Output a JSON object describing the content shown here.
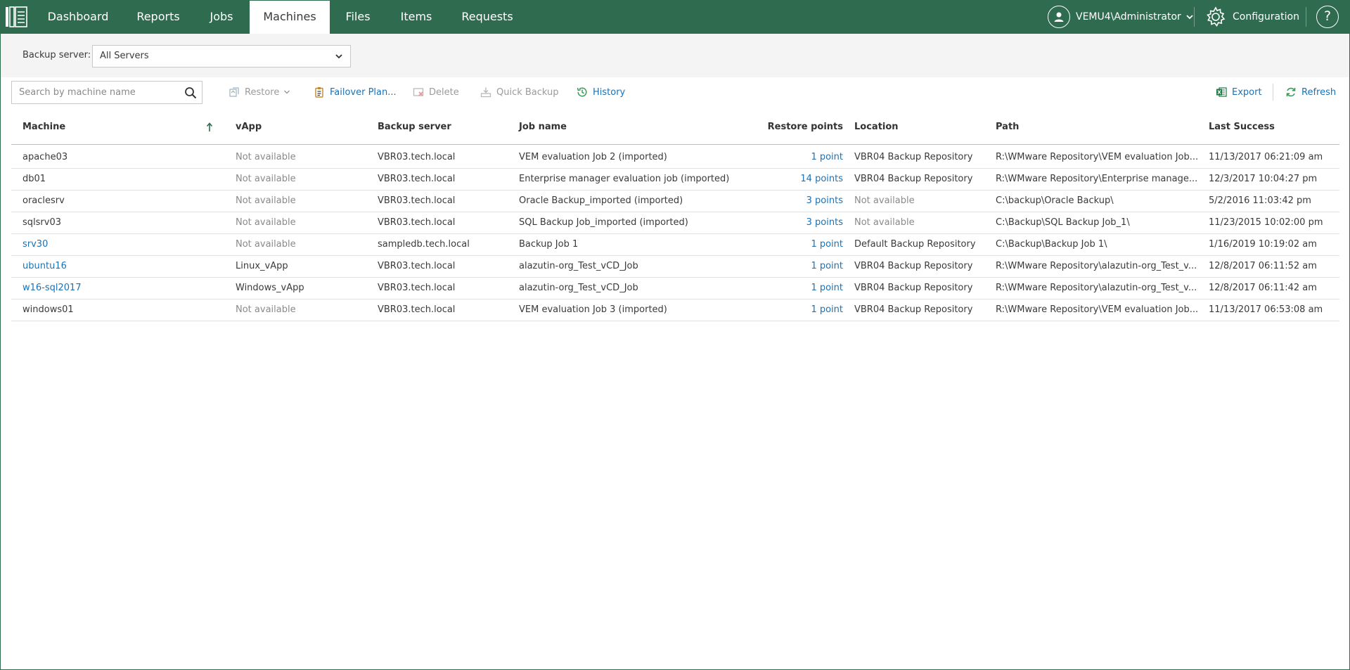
{
  "nav": {
    "tabs": [
      {
        "label": "Dashboard"
      },
      {
        "label": "Reports"
      },
      {
        "label": "Jobs"
      },
      {
        "label": "Machines"
      },
      {
        "label": "Files"
      },
      {
        "label": "Items"
      },
      {
        "label": "Requests"
      }
    ],
    "active_tab": "Machines",
    "user": "VEMU4\\Administrator",
    "config_label": "Configuration",
    "help_label": "?"
  },
  "filter": {
    "label": "Backup server:",
    "value": "All Servers"
  },
  "toolbar": {
    "search_placeholder": "Search by machine name",
    "restore": "Restore",
    "failover": "Failover Plan...",
    "delete": "Delete",
    "quick_backup": "Quick Backup",
    "history": "History",
    "export": "Export",
    "refresh": "Refresh"
  },
  "table": {
    "headers": {
      "machine": "Machine",
      "vapp": "vApp",
      "backup_server": "Backup server",
      "job_name": "Job name",
      "restore_points": "Restore points",
      "location": "Location",
      "path": "Path",
      "last_success": "Last Success"
    },
    "rows": [
      {
        "machine": "apache03",
        "vapp": "Not available",
        "backup_server": "VBR03.tech.local",
        "job_name": "VEM evaluation Job 2 (imported)",
        "restore_points": "1 point",
        "location": "VBR04 Backup Repository",
        "path": "R:\\WMware Repository\\VEM evaluation Job...",
        "last_success": "11/13/2017 06:21:09 am"
      },
      {
        "machine": "db01",
        "vapp": "Not available",
        "backup_server": "VBR03.tech.local",
        "job_name": "Enterprise manager evaluation job (imported)",
        "restore_points": "14 points",
        "location": "VBR04 Backup Repository",
        "path": "R:\\WMware Repository\\Enterprise manage...",
        "last_success": "12/3/2017 10:04:27 pm"
      },
      {
        "machine": "oraclesrv",
        "vapp": "Not available",
        "backup_server": "VBR03.tech.local",
        "job_name": "Oracle Backup_imported (imported)",
        "restore_points": "3 points",
        "location": "Not available",
        "path": "C:\\backup\\Oracle Backup\\",
        "last_success": "5/2/2016 11:03:42 pm"
      },
      {
        "machine": "sqlsrv03",
        "vapp": "Not available",
        "backup_server": "VBR03.tech.local",
        "job_name": "SQL Backup Job_imported (imported)",
        "restore_points": "3 points",
        "location": "Not available",
        "path": "C:\\Backup\\SQL Backup Job_1\\",
        "last_success": "11/23/2015 10:02:00 pm"
      },
      {
        "machine": "srv30",
        "vapp": "Not available",
        "backup_server": "sampledb.tech.local",
        "job_name": "Backup Job 1",
        "restore_points": "1 point",
        "location": "Default Backup Repository",
        "path": "C:\\Backup\\Backup Job 1\\",
        "last_success": "1/16/2019 10:19:02 am"
      },
      {
        "machine": "ubuntu16",
        "vapp": "Linux_vApp",
        "backup_server": "VBR03.tech.local",
        "job_name": "alazutin-org_Test_vCD_Job",
        "restore_points": "1 point",
        "location": "VBR04 Backup Repository",
        "path": "R:\\WMware Repository\\alazutin-org_Test_v...",
        "last_success": "12/8/2017 06:11:52 am"
      },
      {
        "machine": "w16-sql2017",
        "vapp": "Windows_vApp",
        "backup_server": "VBR03.tech.local",
        "job_name": "alazutin-org_Test_vCD_Job",
        "restore_points": "1 point",
        "location": "VBR04 Backup Repository",
        "path": "R:\\WMware Repository\\alazutin-org_Test_v...",
        "last_success": "12/8/2017 06:11:42 am"
      },
      {
        "machine": "windows01",
        "vapp": "Not available",
        "backup_server": "VBR03.tech.local",
        "job_name": "VEM evaluation Job 3 (imported)",
        "restore_points": "1 point",
        "location": "VBR04 Backup Repository",
        "path": "R:\\WMware Repository\\VEM evaluation Job...",
        "last_success": "11/13/2017 06:53:08 am"
      }
    ],
    "link_machines": [
      "srv30",
      "ubuntu16",
      "w16-sql2017"
    ]
  },
  "colors": {
    "brand": "#2e6b4f",
    "link": "#1a72b6",
    "muted": "#8a8a8a"
  },
  "icons": [
    "app-logo-icon",
    "user-avatar-icon",
    "chevron-down-icon",
    "gear-icon",
    "help-icon",
    "search-icon",
    "restore-icon",
    "failover-plan-icon",
    "delete-icon",
    "quick-backup-icon",
    "history-icon",
    "excel-export-icon",
    "refresh-icon",
    "sort-ascending-icon"
  ]
}
